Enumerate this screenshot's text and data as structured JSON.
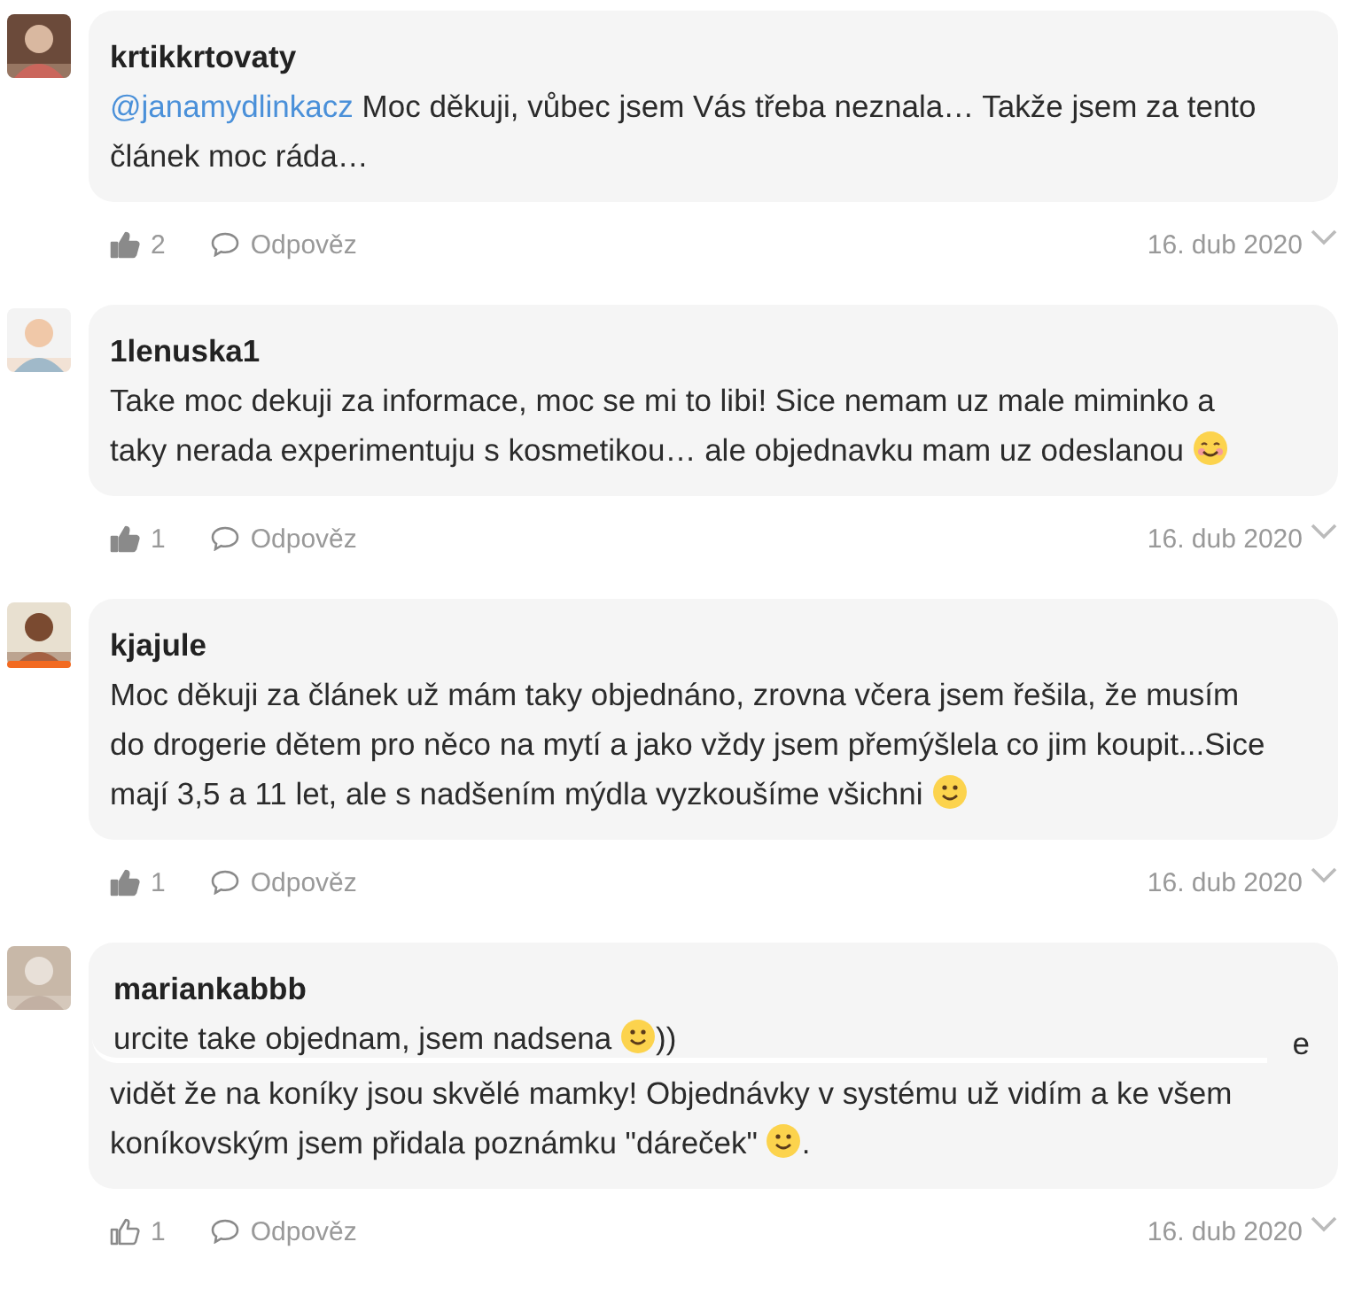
{
  "comments": [
    {
      "author": "krtikkrtovaty",
      "avatar": {
        "kind": "picture",
        "ring": false
      },
      "body": [
        {
          "kind": "mention",
          "text": "@janamydlinkacz"
        },
        {
          "kind": "text",
          "text": " Moc děkuji, vůbec jsem Vás třeba neznala… Takže jsem za tento článek moc ráda…"
        }
      ],
      "likes": "2",
      "liked": true,
      "reply": "Odpověz",
      "date": "16. dub 2020"
    },
    {
      "author": "1lenuska1",
      "avatar": {
        "kind": "picture",
        "ring": false
      },
      "body": [
        {
          "kind": "text",
          "text": "Take moc dekuji za informace, moc se mi to libi! Sice nemam uz male miminko a taky nerada experimentuju s kosmetikou… ale objednavku mam uz odeslanou "
        },
        {
          "kind": "blush-emoji"
        }
      ],
      "likes": "1",
      "liked": true,
      "reply": "Odpověz",
      "date": "16. dub 2020"
    },
    {
      "author": "kjajule",
      "avatar": {
        "kind": "picture",
        "ring": true
      },
      "body": [
        {
          "kind": "text",
          "text": "Moc děkuji za článek už mám taky objednáno, zrovna včera jsem řešila, že musím do drogerie dětem pro něco na mytí a jako vždy jsem přemýšlela co jim koupit...Sice mají 3,5 a 11 let, ale s nadšením mýdla vyzkoušíme všichni "
        },
        {
          "kind": "smile-emoji"
        }
      ],
      "likes": "1",
      "liked": true,
      "reply": "Odpověz",
      "date": "16. dub 2020"
    },
    {
      "author": "mariankabbb",
      "avatar": {
        "kind": "picture",
        "ring": false
      },
      "body": [
        {
          "kind": "text",
          "text": "urcite take objednam, jsem nadsena "
        },
        {
          "kind": "smile-emoji"
        },
        {
          "kind": "text",
          "text": "))"
        }
      ],
      "covered_comment": {
        "cut_line": "e",
        "lines": [
          [
            {
              "kind": "text",
              "text": "vidět že na koníky jsou skvělé mamky! Objednávky v systému už vidím a ke všem"
            }
          ],
          [
            {
              "kind": "text",
              "text": "koníkovským jsem přidala poznámku \"dáreček\" "
            },
            {
              "kind": "smile-emoji"
            },
            {
              "kind": "text",
              "text": "."
            }
          ]
        ]
      },
      "likes": "1",
      "liked": false,
      "reply": "Odpověz",
      "date": "16. dub 2020"
    }
  ]
}
